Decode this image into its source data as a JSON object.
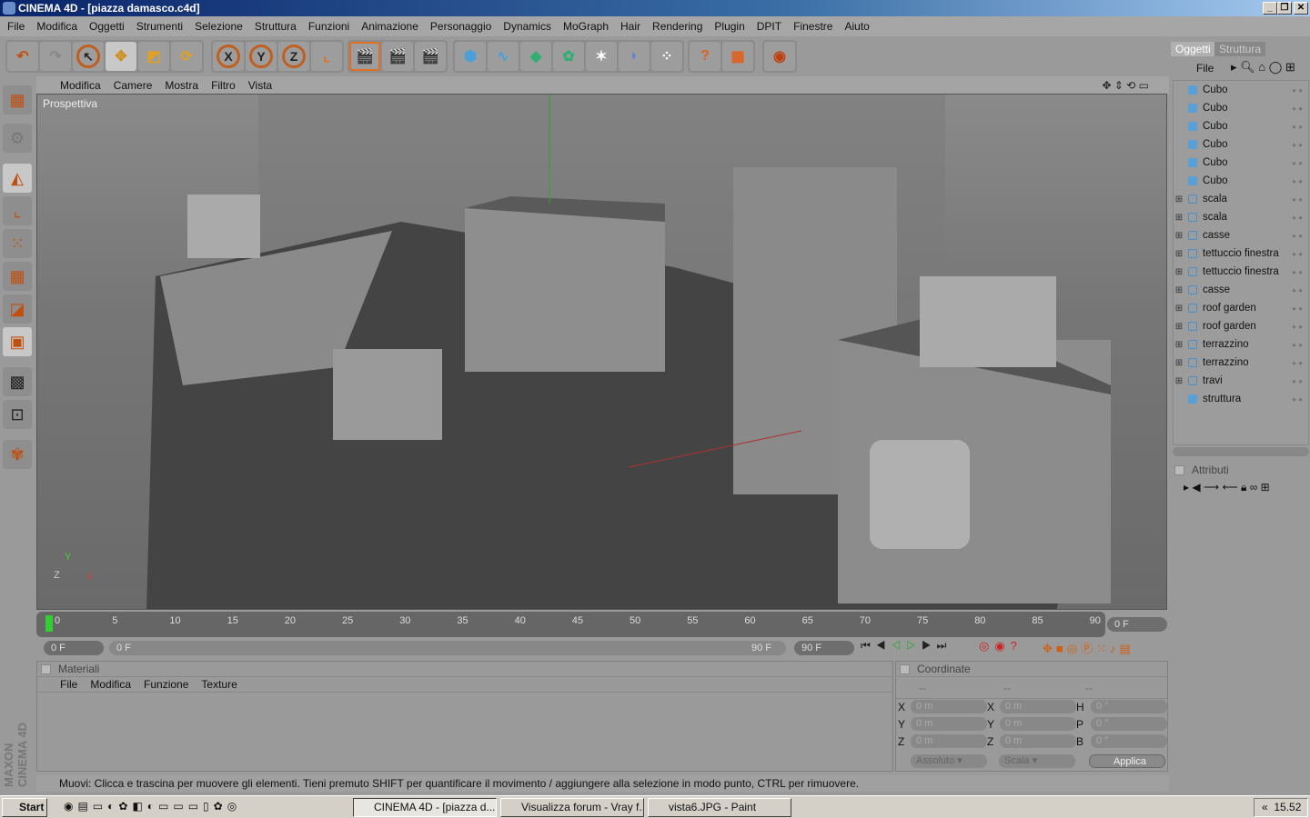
{
  "window": {
    "title": "CINEMA 4D - [piazza damasco.c4d]"
  },
  "menu": [
    "File",
    "Modifica",
    "Oggetti",
    "Strumenti",
    "Selezione",
    "Struttura",
    "Funzioni",
    "Animazione",
    "Personaggio",
    "Dynamics",
    "MoGraph",
    "Hair",
    "Rendering",
    "Plugin",
    "DPIT",
    "Finestre",
    "Aiuto"
  ],
  "viewport": {
    "menu": [
      "Modifica",
      "Camere",
      "Mostra",
      "Filtro",
      "Vista"
    ],
    "label": "Prospettiva"
  },
  "timeline": {
    "ticks": [
      "0",
      "5",
      "10",
      "15",
      "20",
      "25",
      "30",
      "35",
      "40",
      "45",
      "50",
      "55",
      "60",
      "65",
      "70",
      "75",
      "80",
      "85",
      "90"
    ],
    "current": "0 F",
    "start": "0 F",
    "range_start": "0 F",
    "range_end": "90 F",
    "end": "90 F"
  },
  "materials": {
    "title": "Materiali",
    "menu": [
      "File",
      "Modifica",
      "Funzione",
      "Texture"
    ]
  },
  "coordinates": {
    "title": "Coordinate",
    "headers": [
      "--",
      "--",
      "--"
    ],
    "rows": [
      {
        "l1": "X",
        "v1": "0 m",
        "l2": "X",
        "v2": "0 m",
        "l3": "H",
        "v3": "0 °"
      },
      {
        "l1": "Y",
        "v1": "0 m",
        "l2": "Y",
        "v2": "0 m",
        "l3": "P",
        "v3": "0 °"
      },
      {
        "l1": "Z",
        "v1": "0 m",
        "l2": "Z",
        "v2": "0 m",
        "l3": "B",
        "v3": "0 °"
      }
    ],
    "mode": "Assoluto",
    "scale": "Scala",
    "apply": "Applica"
  },
  "status": "Muovi: Clicca e trascina per muovere gli elementi. Tieni premuto SHIFT per quantificare il movimento / aggiungere alla selezione in modo punto, CTRL per rimuovere.",
  "objects_panel": {
    "tabs": [
      "Oggetti",
      "Struttura"
    ],
    "menu": "File",
    "items": [
      {
        "name": "Cubo",
        "group": false
      },
      {
        "name": "Cubo",
        "group": false
      },
      {
        "name": "Cubo",
        "group": false
      },
      {
        "name": "Cubo",
        "group": false
      },
      {
        "name": "Cubo",
        "group": false
      },
      {
        "name": "Cubo",
        "group": false
      },
      {
        "name": "scala",
        "group": true
      },
      {
        "name": "scala",
        "group": true
      },
      {
        "name": "casse",
        "group": true
      },
      {
        "name": "tettuccio finestra",
        "group": true
      },
      {
        "name": "tettuccio finestra",
        "group": true
      },
      {
        "name": "casse",
        "group": true
      },
      {
        "name": "roof garden",
        "group": true
      },
      {
        "name": "roof garden",
        "group": true
      },
      {
        "name": "terrazzino",
        "group": true
      },
      {
        "name": "terrazzino",
        "group": true
      },
      {
        "name": "travi",
        "group": true
      },
      {
        "name": "struttura",
        "group": false
      }
    ]
  },
  "attributes_panel": {
    "title": "Attributi"
  },
  "brand": "MAXON CINEMA 4D",
  "taskbar": {
    "start": "Start",
    "tasks": [
      "CINEMA 4D - [piazza d...",
      "Visualizza forum - Vray f...",
      "vista6.JPG - Paint"
    ],
    "clock": "15.52"
  }
}
